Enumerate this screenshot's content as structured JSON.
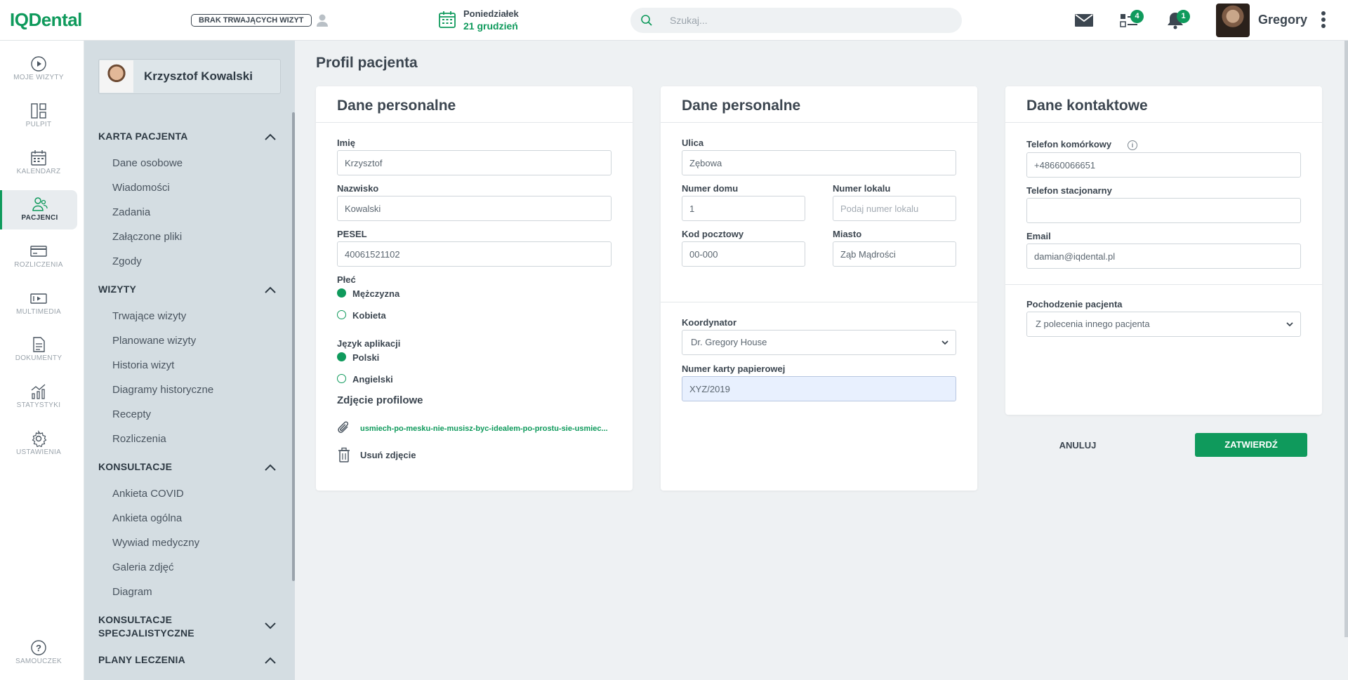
{
  "app": {
    "logo": "IQDental",
    "visits_badge": "BRAK TRWAJĄCYCH WIZYT",
    "date_day": "Poniedziałek",
    "date_date": "21 grudzień",
    "search_placeholder": "Szukaj...",
    "tasks_count": "4",
    "notifications_count": "1",
    "user_name": "Gregory"
  },
  "nav": [
    {
      "label": "MOJE WIZYTY",
      "icon": "play-circle-icon"
    },
    {
      "label": "PULPIT",
      "icon": "dashboard-icon"
    },
    {
      "label": "KALENDARZ",
      "icon": "calendar-icon"
    },
    {
      "label": "PACJENCI",
      "icon": "patients-icon",
      "active": true
    },
    {
      "label": "ROZLICZENIA",
      "icon": "credit-card-icon"
    },
    {
      "label": "MULTIMEDIA",
      "icon": "media-icon"
    },
    {
      "label": "DOKUMENTY",
      "icon": "document-icon"
    },
    {
      "label": "STATYSTYKI",
      "icon": "stats-icon"
    },
    {
      "label": "USTAWIENIA",
      "icon": "gear-icon"
    },
    {
      "label": "SAMOUCZEK",
      "icon": "help-icon"
    }
  ],
  "sidebar": {
    "patient_name": "Krzysztof Kowalski",
    "sections": [
      {
        "title": "KARTA PACJENTA",
        "items": [
          "Dane osobowe",
          "Wiadomości",
          "Zadania",
          "Załączone pliki",
          "Zgody"
        ]
      },
      {
        "title": "WIZYTY",
        "items": [
          "Trwające wizyty",
          "Planowane wizyty",
          "Historia wizyt",
          "Diagramy historyczne",
          "Recepty",
          "Rozliczenia"
        ]
      },
      {
        "title": "KONSULTACJE",
        "items": [
          "Ankieta COVID",
          "Ankieta ogólna",
          "Wywiad medyczny",
          "Galeria zdjęć",
          "Diagram"
        ]
      },
      {
        "title_line1": "KONSULTACJE",
        "title_line2": "SPECJALISTYCZNE"
      },
      {
        "title": "PLANY LECZENIA"
      }
    ]
  },
  "main": {
    "page_title": "Profil pacjenta",
    "card1": {
      "title": "Dane personalne",
      "first_name_label": "Imię",
      "first_name": "Krzysztof",
      "last_name_label": "Nazwisko",
      "last_name": "Kowalski",
      "pesel_label": "PESEL",
      "pesel": "40061521102",
      "gender_label": "Płeć",
      "gender_options": [
        "Mężczyzna",
        "Kobieta"
      ],
      "language_label": "Język aplikacji",
      "language_options": [
        "Polski",
        "Angielski"
      ],
      "photo_label": "Zdjęcie profilowe",
      "photo_file": "usmiech-po-mesku-nie-musisz-byc-idealem-po-prostu-sie-usmiec...",
      "remove_photo": "Usuń zdjęcie"
    },
    "card2": {
      "title": "Dane personalne",
      "street_label": "Ulica",
      "street": "Zębowa",
      "house_label": "Numer domu",
      "house": "1",
      "flat_label": "Numer lokalu",
      "flat_placeholder": "Podaj numer lokalu",
      "zip_label": "Kod pocztowy",
      "zip": "00-000",
      "city_label": "Miasto",
      "city": "Ząb Mądrości",
      "coordinator_label": "Koordynator",
      "coordinator": "Dr. Gregory House",
      "card_no_label": "Numer karty papierowej",
      "card_no": "XYZ/2019"
    },
    "card3": {
      "title": "Dane kontaktowe",
      "mobile_label": "Telefon komórkowy",
      "mobile": "+48660066651",
      "landline_label": "Telefon stacjonarny",
      "landline": "",
      "email_label": "Email",
      "email": "damian@iqdental.pl",
      "origin_label": "Pochodzenie pacjenta",
      "origin": "Z polecenia innego pacjenta"
    },
    "cancel_label": "ANULUJ",
    "confirm_label": "ZATWIERDŹ"
  }
}
